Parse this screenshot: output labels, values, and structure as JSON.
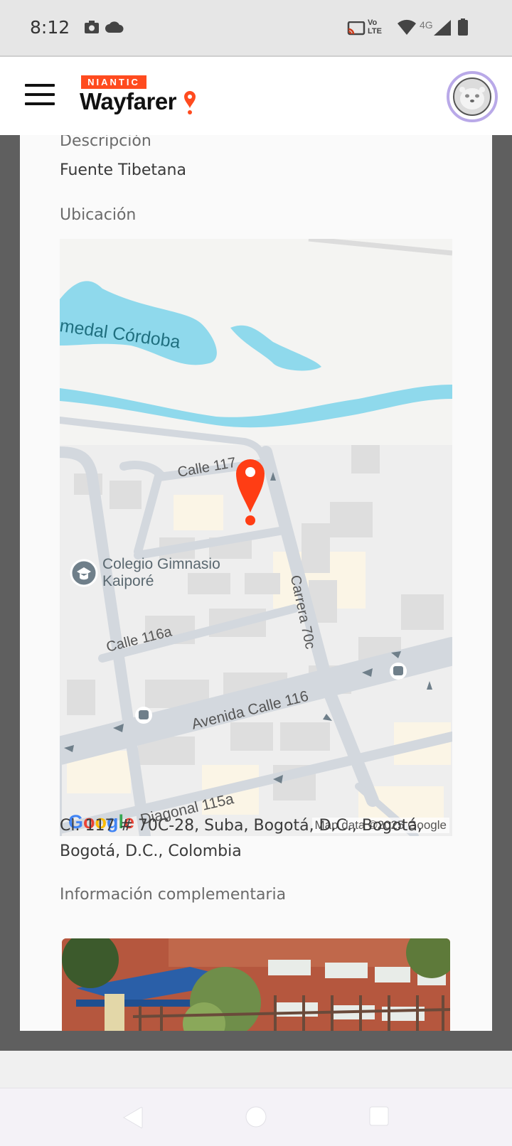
{
  "status_bar": {
    "time": "8:12",
    "network": "4G",
    "volte": "Vo LTE",
    "icons": [
      "camera-icon",
      "cloud-icon",
      "cast-icon",
      "wifi-icon",
      "signal-icon",
      "battery-icon"
    ]
  },
  "header": {
    "brand_badge": "NIANTIC",
    "brand_name": "Wayfarer",
    "accent_color": "#ff4b1f"
  },
  "details": {
    "description_label": "Descripción",
    "description_value": "Fuente Tibetana",
    "location_label": "Ubicación",
    "address_line1": "Cl. 117 # 70C-28, Suba, Bogotá, D.C., Bogotá,",
    "address_line2": "Bogotá, D.C., Colombia",
    "supplementary_label": "Información complementaria"
  },
  "map": {
    "labels": {
      "lake": "medal Córdoba",
      "calle_117": "Calle 117",
      "poi": "Colegio Gimnasio",
      "poi_line2": "Kaiporé",
      "carrera": "Carrera 70c",
      "calle_116a": "Calle 116a",
      "avenida": "Avenida Calle 116",
      "diagonal": "Diagonal 115a"
    },
    "attribution": "Map data ©2025 Google",
    "google": "Google"
  }
}
